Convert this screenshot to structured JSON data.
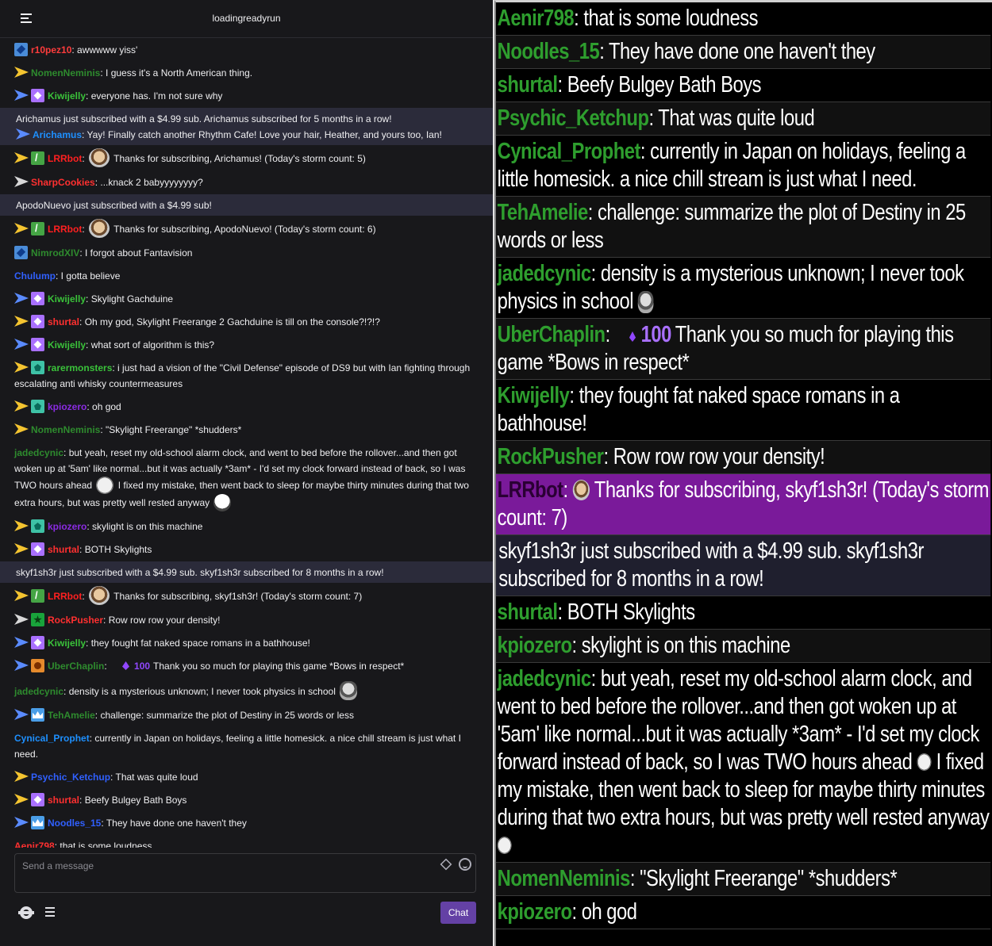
{
  "header": {
    "channel": "loadingreadyrun"
  },
  "chat": [
    {
      "type": "msg",
      "badges": [
        "blue"
      ],
      "arrow": null,
      "user": "r10pez10",
      "color": "#ff3c3c",
      "text": "awwwww yiss'"
    },
    {
      "type": "msg",
      "badges": [],
      "arrow": "yellow",
      "user": "NomenNeminis",
      "color": "#2e8b2e",
      "text": "I guess it's a North American thing."
    },
    {
      "type": "msg",
      "badges": [
        "purple"
      ],
      "arrow": "blue",
      "user": "Kiwijelly",
      "color": "#3ac23a",
      "text": "everyone has. I'm not sure why"
    },
    {
      "type": "notice",
      "notice": "Arichamus just subscribed with a $4.99 sub. Arichamus subscribed for 5 months in a row!",
      "badges": [],
      "arrow": "blue",
      "user": "Arichamus",
      "color": "#1e90ff",
      "text": "Yay! Finally catch another Rhythm Cafe! Love your hair, Heather, and yours too, Ian!"
    },
    {
      "type": "msg",
      "badges": [
        "green"
      ],
      "arrow": "yellow",
      "user": "LRRbot",
      "color": "#ff2020",
      "emote": "emote",
      "text": "Thanks for subscribing, Arichamus! (Today's storm count: 5)"
    },
    {
      "type": "msg",
      "badges": [],
      "arrow": "white",
      "user": "SharpCookies",
      "color": "#ff3030",
      "text": "...knack 2 babyyyyyyyy?"
    },
    {
      "type": "notice-only",
      "notice": "ApodoNuevo just subscribed with a $4.99 sub!"
    },
    {
      "type": "msg",
      "badges": [
        "green"
      ],
      "arrow": "yellow",
      "user": "LRRbot",
      "color": "#ff2020",
      "emote": "emote",
      "text": "Thanks for subscribing, ApodoNuevo! (Today's storm count: 6)"
    },
    {
      "type": "msg",
      "badges": [
        "blue"
      ],
      "arrow": null,
      "user": "NimrodXIV",
      "color": "#2e8b2e",
      "text": "I forgot about Fantavision"
    },
    {
      "type": "msg",
      "badges": [],
      "arrow": null,
      "user": "Chulump",
      "color": "#3060ff",
      "text": "I gotta believe"
    },
    {
      "type": "msg",
      "badges": [
        "purple"
      ],
      "arrow": "blue",
      "user": "Kiwijelly",
      "color": "#3ac23a",
      "text": "Skylight Gachduine"
    },
    {
      "type": "msg",
      "badges": [
        "purple"
      ],
      "arrow": "yellow",
      "user": "shurtal",
      "color": "#ff3030",
      "text": "Oh my god, Skylight Freerange 2 Gachduine is till on the console?!?!?"
    },
    {
      "type": "msg",
      "badges": [
        "purple"
      ],
      "arrow": "blue",
      "user": "Kiwijelly",
      "color": "#3ac23a",
      "text": "what sort of algorithm is this?"
    },
    {
      "type": "msg",
      "badges": [
        "teal"
      ],
      "arrow": "yellow",
      "user": "rarermonsters",
      "color": "#3ac23a",
      "text": "i just had a vision of the \"Civil Defense\" episode of DS9 but with Ian fighting through escalating anti whisky countermeasures"
    },
    {
      "type": "msg",
      "badges": [
        "teal"
      ],
      "arrow": "yellow",
      "user": "kpiozero",
      "color": "#8a2be2",
      "text": "oh god"
    },
    {
      "type": "msg",
      "badges": [],
      "arrow": "yellow",
      "user": "NomenNeminis",
      "color": "#2e8b2e",
      "text": "\"Skylight Freerange\" *shudders*"
    },
    {
      "type": "msg-long",
      "badges": [],
      "arrow": null,
      "user": "jadedcynic",
      "color": "#2e8b2e",
      "text1": "but yeah, reset my old-school alarm clock, and went to bed before the rollover...and then got woken up at '5am' like normal...but it was actually *3am* - I'd set my clock forward instead of back, so I was TWO hours ahead",
      "text2": "I fixed my mistake, then went back to sleep for maybe thirty minutes during that two extra hours, but was pretty well rested anyway"
    },
    {
      "type": "msg",
      "badges": [
        "teal"
      ],
      "arrow": "yellow",
      "user": "kpiozero",
      "color": "#8a2be2",
      "text": "skylight is on this machine"
    },
    {
      "type": "msg",
      "badges": [
        "purple"
      ],
      "arrow": "yellow",
      "user": "shurtal",
      "color": "#ff3030",
      "text": "BOTH Skylights"
    },
    {
      "type": "notice-only",
      "notice": "skyf1sh3r just subscribed with a $4.99 sub. skyf1sh3r subscribed for 8 months in a row!"
    },
    {
      "type": "msg",
      "badges": [
        "green"
      ],
      "arrow": "yellow",
      "user": "LRRbot",
      "color": "#ff2020",
      "emote": "emote",
      "text": "Thanks for subscribing, skyf1sh3r! (Today's storm count: 7)"
    },
    {
      "type": "msg",
      "badges": [
        "star"
      ],
      "arrow": "white",
      "user": "RockPusher",
      "color": "#ff3030",
      "text": "Row row row your density!"
    },
    {
      "type": "msg",
      "badges": [
        "purple"
      ],
      "arrow": "blue",
      "user": "Kiwijelly",
      "color": "#3ac23a",
      "text": "they fought fat naked space romans in a bathhouse!"
    },
    {
      "type": "msg-bits",
      "badges": [
        "orange"
      ],
      "arrow": "blue",
      "user": "UberChaplin",
      "color": "#2e8b2e",
      "bits": "100",
      "text": "Thank you so much for playing this game *Bows in respect*"
    },
    {
      "type": "msg",
      "badges": [],
      "arrow": null,
      "user": "jadedcynic",
      "color": "#2e8b2e",
      "emote": "photo-after",
      "text": "density is a mysterious unknown; I never took physics in school"
    },
    {
      "type": "msg",
      "badges": [
        "crown"
      ],
      "arrow": "blue",
      "user": "TehAmelie",
      "color": "#2e8b2e",
      "text": "challenge: summarize the plot of Destiny in 25 words or less"
    },
    {
      "type": "msg",
      "badges": [],
      "arrow": null,
      "user": "Cynical_Prophet",
      "color": "#1e90ff",
      "text": "currently in Japan on holidays, feeling a little homesick. a nice chill stream is just what I need."
    },
    {
      "type": "msg",
      "badges": [],
      "arrow": "yellow",
      "user": "Psychic_Ketchup",
      "color": "#3060ff",
      "text": "That was quite loud"
    },
    {
      "type": "msg",
      "badges": [
        "purple"
      ],
      "arrow": "yellow",
      "user": "shurtal",
      "color": "#ff3030",
      "text": "Beefy Bulgey Bath Boys"
    },
    {
      "type": "msg",
      "badges": [
        "crown"
      ],
      "arrow": "blue",
      "user": "Noodles_15",
      "color": "#3060ff",
      "text": "They have done one haven't they"
    },
    {
      "type": "msg",
      "badges": [],
      "arrow": null,
      "user": "Aenir798",
      "color": "#ff3030",
      "text": "that is some loudness"
    }
  ],
  "input": {
    "placeholder": "Send a message"
  },
  "chat_button": {
    "label": "Chat"
  },
  "icons": {
    "menu": "hamburger-icon",
    "bits": "bits-icon",
    "emote": "smiley-icon",
    "settings": "gear-icon",
    "viewers": "list-icon"
  },
  "overlay": [
    {
      "kind": "plain",
      "user": "Aenir798",
      "color": "#2e9e2e",
      "text": "that is some loudness"
    },
    {
      "kind": "plain",
      "user": "Noodles_15",
      "color": "#2e9e2e",
      "text": "They have done one haven't they",
      "alt": true
    },
    {
      "kind": "plain",
      "user": "shurtal",
      "color": "#2e9e2e",
      "text": "Beefy Bulgey Bath Boys"
    },
    {
      "kind": "plain",
      "user": "Psychic_Ketchup",
      "color": "#2e9e2e",
      "text": "That was quite loud",
      "alt": true
    },
    {
      "kind": "plain",
      "user": "Cynical_Prophet",
      "color": "#2e9e2e",
      "text": "currently in Japan on holidays, feeling a little homesick. a nice chill stream is just what I need."
    },
    {
      "kind": "plain",
      "user": "TehAmelie",
      "color": "#2e9e2e",
      "text": "challenge: summarize the plot of Destiny in 25 words or less",
      "alt": true
    },
    {
      "kind": "photo",
      "user": "jadedcynic",
      "color": "#2e9e2e",
      "text": "density is a mysterious unknown; I never took physics in school"
    },
    {
      "kind": "bits",
      "user": "UberChaplin",
      "color": "#2e9e2e",
      "bits": "100",
      "text": "Thank you so much for playing this game *Bows in respect*",
      "alt": true
    },
    {
      "kind": "plain",
      "user": "Kiwijelly",
      "color": "#2e9e2e",
      "text": "they fought fat naked space romans in a bathhouse!"
    },
    {
      "kind": "plain",
      "user": "RockPusher",
      "color": "#2e9e2e",
      "text": "Row row row your density!",
      "alt": true
    },
    {
      "kind": "lrr",
      "user": "LRRbot",
      "color": "#2a0033",
      "text": "Thanks for subscribing, skyf1sh3r! (Today's storm count: 7)"
    },
    {
      "kind": "sub",
      "text": "skyf1sh3r just subscribed with a $4.99 sub. skyf1sh3r subscribed for 8 months in a row!"
    },
    {
      "kind": "plain",
      "user": "shurtal",
      "color": "#2e9e2e",
      "text": "BOTH Skylights"
    },
    {
      "kind": "plain",
      "user": "kpiozero",
      "color": "#2e9e2e",
      "text": "skylight is on this machine",
      "alt": true
    },
    {
      "kind": "long",
      "user": "jadedcynic",
      "color": "#2e9e2e",
      "text1": "but yeah, reset my old-school alarm clock, and went to bed before the rollover...and then got woken up at '5am' like normal...but it was actually *3am* - I'd set my clock forward instead of back, so I was TWO hours ahead",
      "text2": "I fixed my mistake, then went back to sleep for maybe thirty minutes during that two extra hours, but was pretty well rested anyway"
    },
    {
      "kind": "plain",
      "user": "NomenNeminis",
      "color": "#2e9e2e",
      "text": "\"Skylight Freerange\" *shudders*",
      "alt": true
    },
    {
      "kind": "plain",
      "user": "kpiozero",
      "color": "#2e9e2e",
      "text": "oh god"
    }
  ]
}
